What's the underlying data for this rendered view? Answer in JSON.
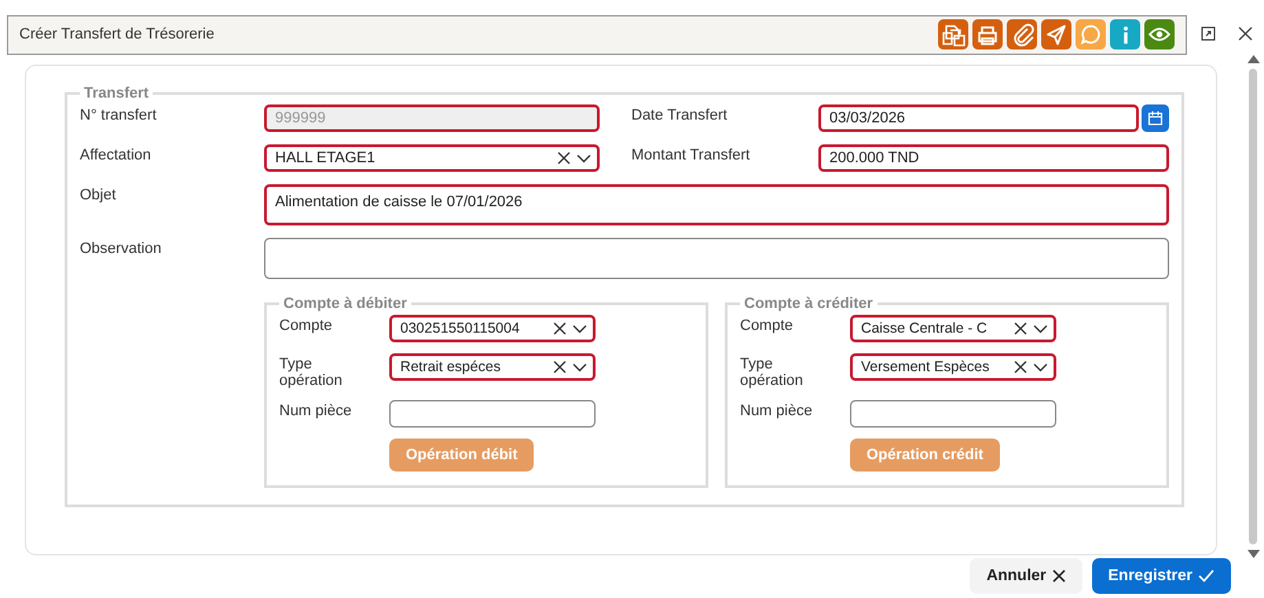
{
  "window": {
    "title": "Créer Transfert de Trésorerie"
  },
  "toolbar": [
    {
      "kind": "documents",
      "color": "#d4600f"
    },
    {
      "kind": "print",
      "color": "#d4600f"
    },
    {
      "kind": "attach",
      "color": "#d4600f"
    },
    {
      "kind": "send",
      "color": "#d4600f"
    },
    {
      "kind": "comment",
      "color": "#f7a745"
    },
    {
      "kind": "info",
      "color": "#17a9c4"
    },
    {
      "kind": "view",
      "color": "#4a8a12"
    }
  ],
  "transfert": {
    "legend": "Transfert",
    "fields": [
      {
        "label": "N° transfert",
        "kind": "text",
        "value": "999999",
        "disabled": true,
        "invalid": true
      },
      {
        "label": "Date Transfert",
        "kind": "date",
        "value": "03/03/2026",
        "disabled": false,
        "invalid": true
      },
      {
        "label": "Affectation",
        "kind": "combo",
        "value": "HALL ETAGE1",
        "disabled": false,
        "invalid": true
      },
      {
        "label": "Montant Transfert",
        "kind": "text",
        "value": "200.000 TND",
        "disabled": false,
        "invalid": true
      },
      {
        "label": "Objet",
        "kind": "textarea",
        "value": "Alimentation de caisse le 07/01/2026",
        "disabled": false,
        "invalid": true
      },
      {
        "label": "Observation",
        "kind": "textarea",
        "disabled": false,
        "invalid": false
      }
    ]
  },
  "accounts": [
    {
      "legend": "Compte à débiter",
      "button": "Opération débit",
      "fields": [
        {
          "label": "Compte",
          "kind": "combo",
          "value": "030251550115004",
          "invalid": true
        },
        {
          "label": "Type opération",
          "kind": "combo",
          "value": "Retrait espéces",
          "invalid": true
        },
        {
          "label": "Num pièce",
          "kind": "text",
          "invalid": false
        }
      ]
    },
    {
      "legend": "Compte à créditer",
      "button": "Opération crédit",
      "fields": [
        {
          "label": "Compte",
          "kind": "combo",
          "value": "Caisse Centrale - C",
          "invalid": true
        },
        {
          "label": "Type opération",
          "kind": "combo",
          "value": "Versement Espèces",
          "invalid": true
        },
        {
          "label": "Num pièce",
          "kind": "text",
          "invalid": false
        }
      ]
    }
  ],
  "buttons": [
    {
      "kind": "cancel",
      "label": "Annuler"
    },
    {
      "kind": "save",
      "label": "Enregistrer"
    }
  ]
}
